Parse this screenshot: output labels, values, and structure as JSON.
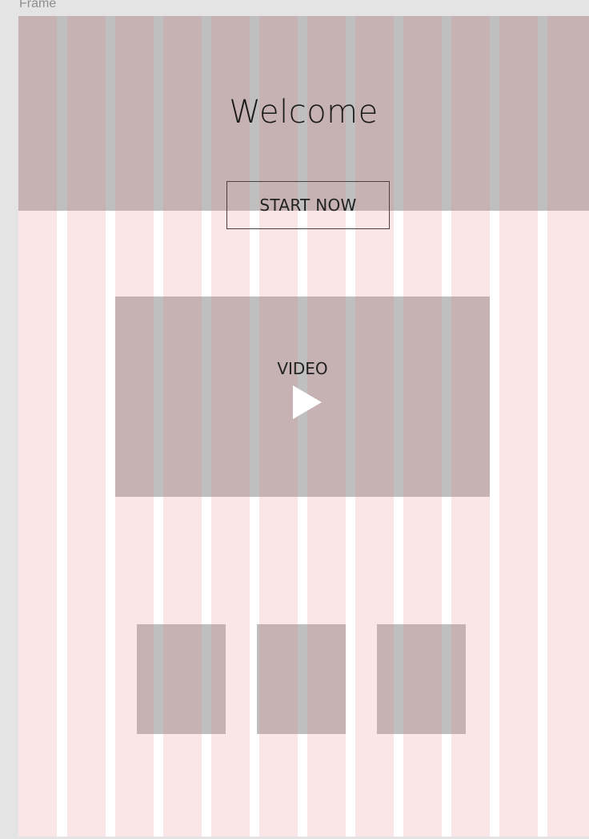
{
  "canvas": {
    "frame_label": "Frame"
  },
  "hero": {
    "title": "Welcome",
    "cta_label": "START NOW"
  },
  "video": {
    "label": "VIDEO",
    "icon": "play-icon"
  },
  "thumbnails": {
    "count": 3
  },
  "colors": {
    "grid_column": "#e27382",
    "placeholder_block": "#bfbfbf",
    "frame_background": "#ffffff",
    "canvas_background": "#e4e4e4"
  },
  "grid": {
    "columns": 12
  }
}
